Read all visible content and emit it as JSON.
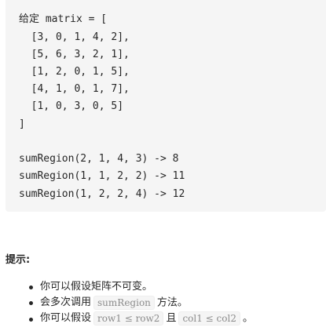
{
  "code_block": {
    "lines": [
      "给定 matrix = [",
      "  [3, 0, 1, 4, 2],",
      "  [5, 6, 3, 2, 1],",
      "  [1, 2, 0, 1, 5],",
      "  [4, 1, 0, 1, 7],",
      "  [1, 0, 3, 0, 5]",
      "]",
      "",
      "sumRegion(2, 1, 4, 3) -> 8",
      "sumRegion(1, 1, 2, 2) -> 11",
      "sumRegion(1, 2, 2, 4) -> 12"
    ]
  },
  "tips": {
    "title": "提示:",
    "items": [
      {
        "text": "你可以假设矩阵不可变。"
      },
      {
        "prefix": "会多次调用",
        "code": "sumRegion",
        "suffix": "方法。"
      },
      {
        "prefix": "你可以假设",
        "code1": "row1 ≤ row2",
        "middle": "且",
        "code2": "col1 ≤ col2",
        "suffix": "。"
      }
    ]
  }
}
